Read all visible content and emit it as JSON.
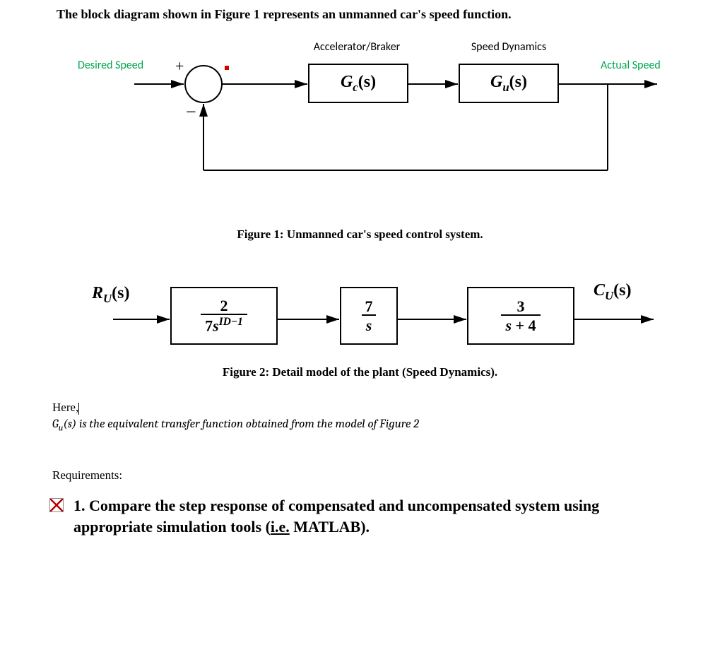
{
  "problem_statement": "The block diagram shown in Figure 1 represents an unmanned car's speed function.",
  "figure1": {
    "label_input": "Desired Speed",
    "label_output": "Actual Speed",
    "accel_label": "Accelerator/Braker",
    "dyn_label": "Speed Dynamics",
    "sum_plus": "+",
    "sum_minus": "−",
    "block1_main": "G",
    "block1_sub": "c",
    "block2_main": "G",
    "block2_sub": "u",
    "arg": "(s)",
    "caption": "Figure 1: Unmanned car's speed control system."
  },
  "figure2": {
    "input_main": "R",
    "input_sub": "U",
    "output_main": "C",
    "output_sub": "U",
    "arg": "(s)",
    "b1_num": "2",
    "b1_den_pre": "7",
    "b1_den_svar": "s",
    "b1_den_exp": "ID−1",
    "b2_num": "7",
    "b2_den": "s",
    "b3_num": "3",
    "b3_den_pre": "s",
    "b3_den_rest": " + 4",
    "caption": "Figure 2: Detail model of the plant (Speed Dynamics)."
  },
  "here_text": "Here,",
  "note_pre": "G",
  "note_sub": "u",
  "note_arg": "(s) ",
  "note_rest": "is the equivalent transfer function obtained from the model of Figure 2",
  "requirements_heading": "Requirements:",
  "req1_num": "1.",
  "req1_a": "Compare the step response of compensated and uncompensated system using appropriate simulation tools (",
  "req1_ie": "i.e.",
  "req1_b": " MATLAB)."
}
